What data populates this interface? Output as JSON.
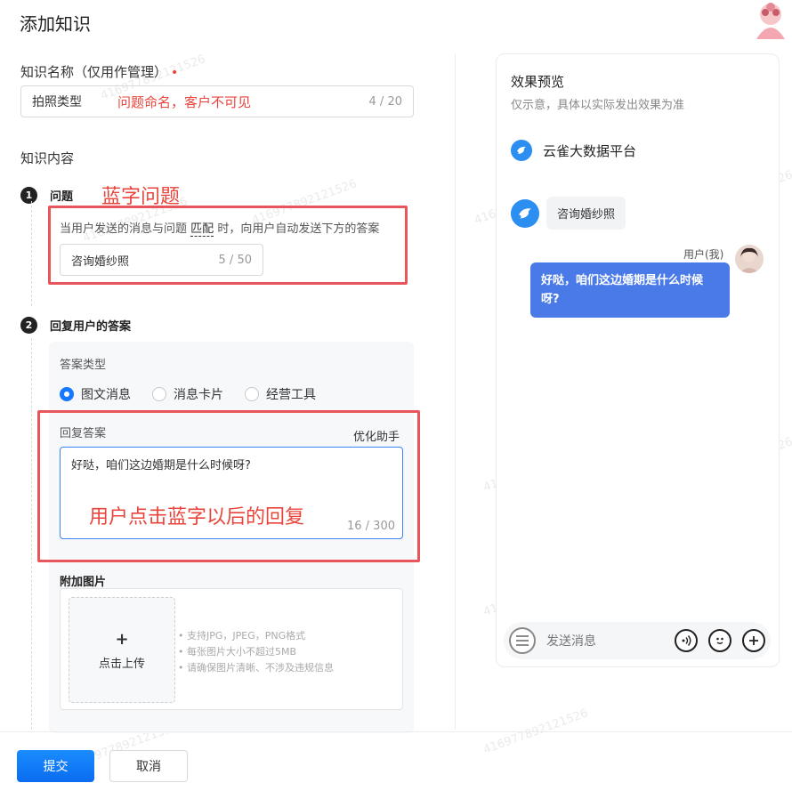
{
  "page": {
    "title": "添加知识"
  },
  "name_field": {
    "label": "知识名称（仅用作管理）",
    "required_mark": "•",
    "value": "拍照类型",
    "annotation": "问题命名，客户不可见",
    "count": "4 / 20"
  },
  "content": {
    "label": "知识内容",
    "step1": {
      "num": "1",
      "label": "问题",
      "annotation": "蓝字问题",
      "desc_before": "当用户发送的消息与问题",
      "desc_match": "匹配",
      "desc_after": "时，向用户自动发送下方的答案",
      "question_value": "咨询婚纱照",
      "question_count": "5 / 50"
    },
    "step2": {
      "num": "2",
      "label": "回复用户的答案",
      "answer_type_label": "答案类型",
      "options": [
        "图文消息",
        "消息卡片",
        "经营工具"
      ],
      "selected": 0,
      "reply_label": "回复答案",
      "assistant": "优化助手",
      "reply_value": "好哒，咱们这边婚期是什么时候呀?",
      "reply_annotation": "用户点击蓝字以后的回复",
      "reply_count": "16 / 300",
      "image_label": "附加图片",
      "upload_plus": "+",
      "upload_label": "点击上传",
      "tips": [
        "支持JPG，JPEG，PNG格式",
        "每张图片大小不超过5MB",
        "请确保图片清晰、不涉及违规信息"
      ]
    }
  },
  "preview": {
    "title": "效果预览",
    "subtitle": "仅示意，具体以实际发出效果为准",
    "bot_name": "云雀大数据平台",
    "bot_message": "咨询婚纱照",
    "user_label": "用户(我)",
    "user_message": "好哒，咱们这边婚期是什么时候呀?",
    "input_placeholder": "发送消息"
  },
  "footer": {
    "submit": "提交",
    "cancel": "取消"
  },
  "watermark": "416977892121526",
  "colors": {
    "primary": "#1677ff",
    "annotation_red": "#e8453c",
    "user_bubble": "#4a7ae8",
    "bot_avatar": "#2b8ef0"
  }
}
